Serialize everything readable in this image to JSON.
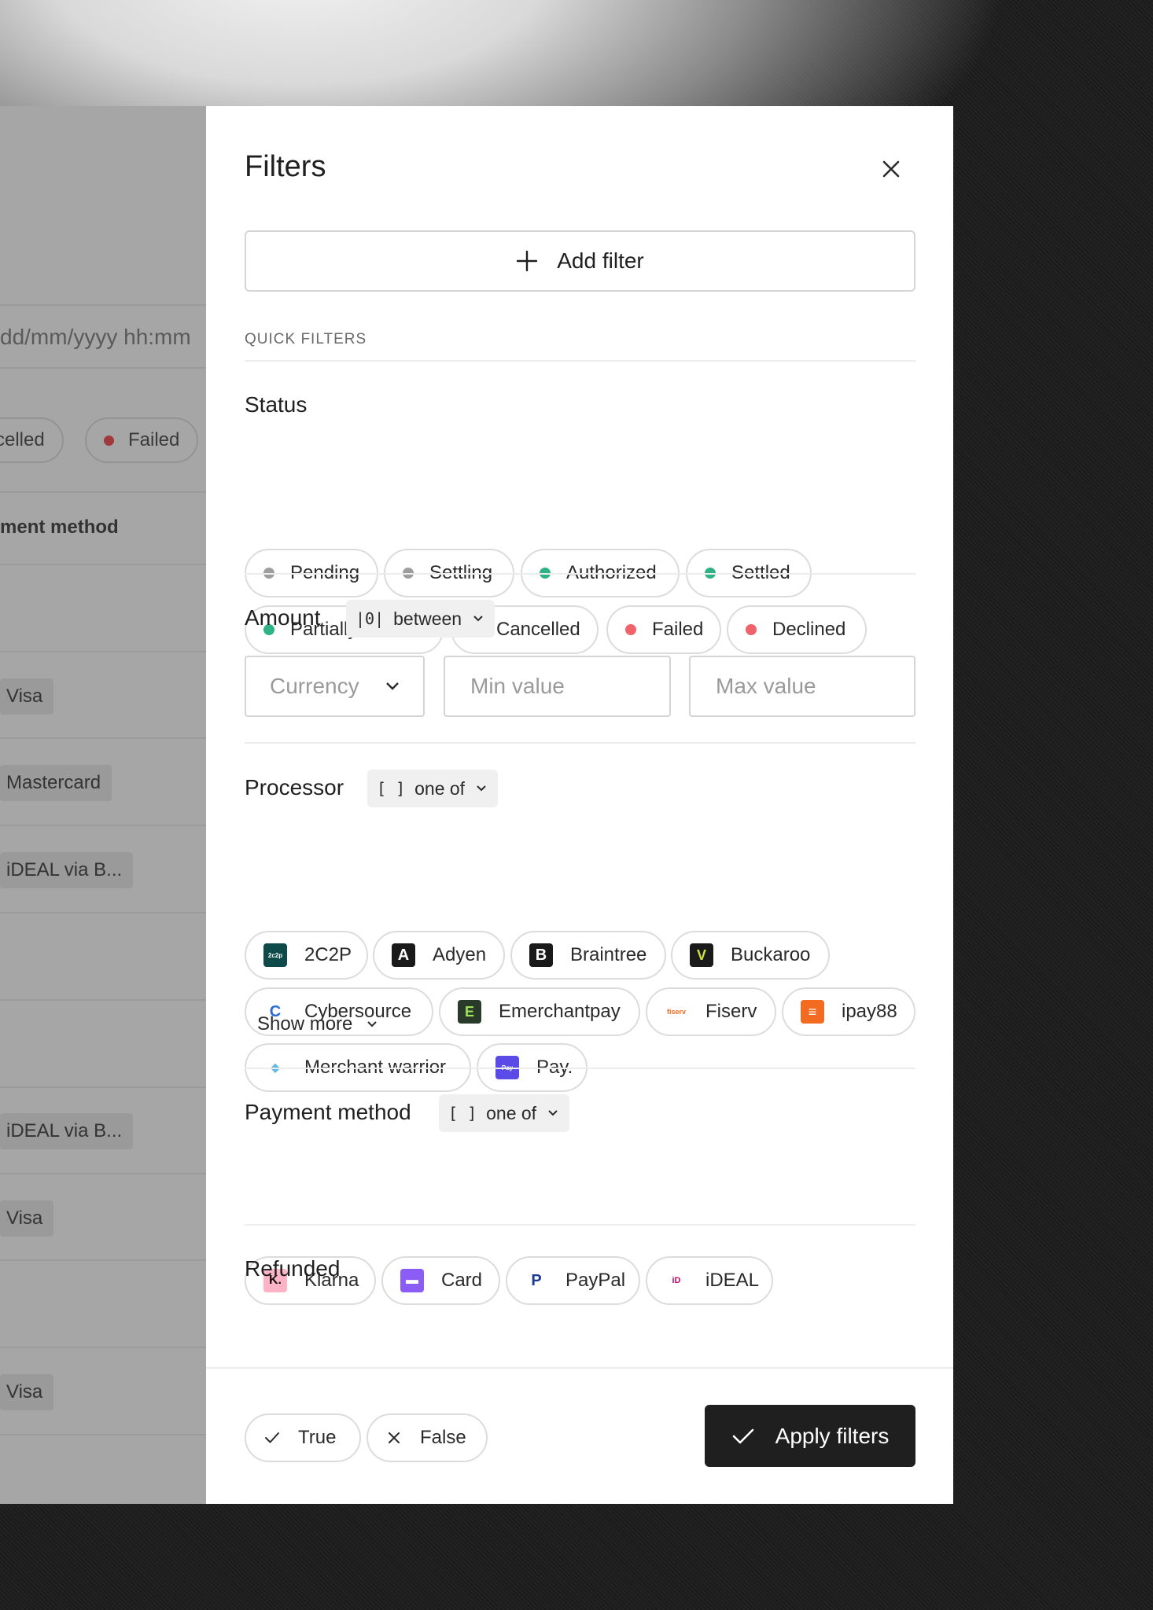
{
  "background": {
    "date_placeholder": "dd/mm/yyyy hh:mm",
    "status_chips": [
      "celled",
      "Failed"
    ],
    "column_header": "ment method",
    "tags": [
      "Visa",
      "Mastercard",
      "iDEAL via B...",
      "iDEAL via B...",
      "Visa",
      "Visa"
    ]
  },
  "panel": {
    "title": "Filters",
    "add_filter_label": "Add filter",
    "quick_filters_label": "QUICK FILTERS",
    "status": {
      "title": "Status",
      "options": [
        {
          "label": "Pending",
          "color": "#9e9e9e"
        },
        {
          "label": "Settling",
          "color": "#9e9e9e"
        },
        {
          "label": "Authorized",
          "color": "#2fb386"
        },
        {
          "label": "Settled",
          "color": "#2fb386"
        },
        {
          "label": "Partially settled",
          "color": "#2fb386"
        },
        {
          "label": "Cancelled",
          "color": "#f2cc2e"
        },
        {
          "label": "Failed",
          "color": "#f0636a"
        },
        {
          "label": "Declined",
          "color": "#f0636a"
        }
      ]
    },
    "amount": {
      "title": "Amount",
      "operator": {
        "symbol": "|0|",
        "label": "between"
      },
      "currency_placeholder": "Currency",
      "min_placeholder": "Min value",
      "max_placeholder": "Max value"
    },
    "processor": {
      "title": "Processor",
      "operator": {
        "symbol": "[ ]",
        "label": "one of"
      },
      "options": [
        {
          "label": "2C2P",
          "icon": "2c2p-icon"
        },
        {
          "label": "Adyen",
          "icon": "adyen-icon"
        },
        {
          "label": "Braintree",
          "icon": "braintree-icon"
        },
        {
          "label": "Buckaroo",
          "icon": "buckaroo-icon"
        },
        {
          "label": "Cybersource",
          "icon": "cybersource-icon"
        },
        {
          "label": "Emerchantpay",
          "icon": "emerchantpay-icon"
        },
        {
          "label": "Fiserv",
          "icon": "fiserv-icon"
        },
        {
          "label": "ipay88",
          "icon": "ipay88-icon"
        },
        {
          "label": "Merchant warrior",
          "icon": "merchant-warrior-icon"
        },
        {
          "label": "Pay.",
          "icon": "pay-icon"
        }
      ],
      "show_more_label": "Show more"
    },
    "payment_method": {
      "title": "Payment method",
      "operator": {
        "symbol": "[ ]",
        "label": "one of"
      },
      "options": [
        {
          "label": "Klarna",
          "icon": "klarna-icon"
        },
        {
          "label": "Card",
          "icon": "card-icon"
        },
        {
          "label": "PayPal",
          "icon": "paypal-icon"
        },
        {
          "label": "iDEAL",
          "icon": "ideal-icon"
        }
      ]
    },
    "refunded": {
      "title": "Refunded",
      "options": [
        {
          "label": "True",
          "icon": "check-icon"
        },
        {
          "label": "False",
          "icon": "x-icon"
        }
      ]
    },
    "apply_label": "Apply filters"
  }
}
